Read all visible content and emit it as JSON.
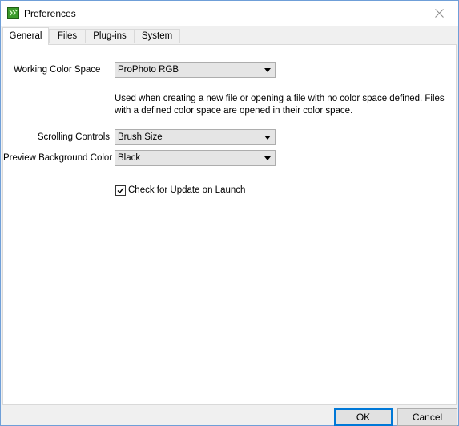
{
  "window": {
    "title": "Preferences"
  },
  "tabs": [
    {
      "label": "General",
      "active": true
    },
    {
      "label": "Files",
      "active": false
    },
    {
      "label": "Plug-ins",
      "active": false
    },
    {
      "label": "System",
      "active": false
    }
  ],
  "general": {
    "working_color_space": {
      "label": "Working Color Space",
      "value": "ProPhoto RGB",
      "hint": "Used when creating a new file or opening a file with no color space defined. Files with a defined color space are opened in their color space."
    },
    "scrolling_controls": {
      "label": "Scrolling Controls",
      "value": "Brush Size"
    },
    "preview_background_color": {
      "label": "Preview Background Color",
      "value": "Black"
    },
    "check_update": {
      "label": "Check for Update on Launch",
      "checked": true
    }
  },
  "footer": {
    "ok_label": "OK",
    "cancel_label": "Cancel"
  },
  "colors": {
    "accent": "#0078d7",
    "window_border": "#6f9fd8",
    "icon_green": "#3a9a2a"
  }
}
